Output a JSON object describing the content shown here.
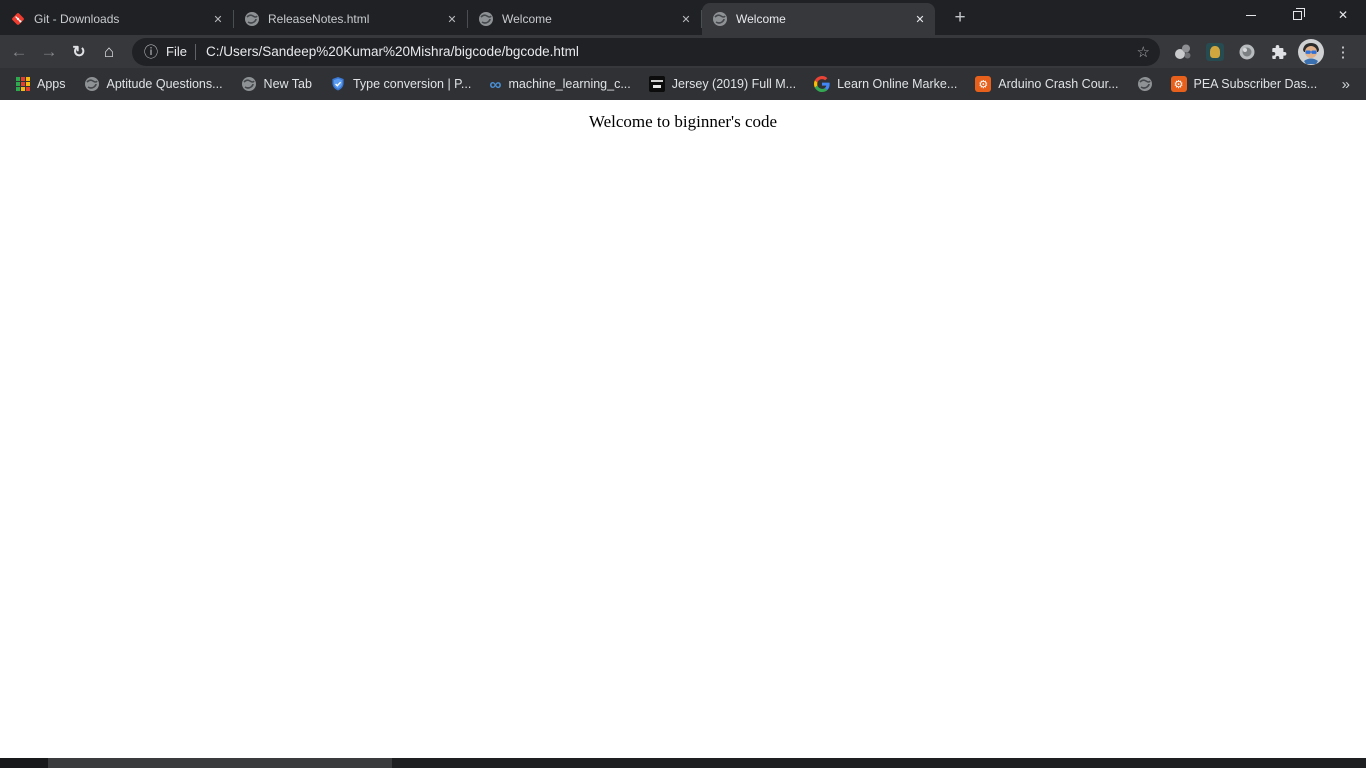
{
  "window_title": "Welcome",
  "tabs": [
    {
      "title": "Git - Downloads",
      "icon": "git",
      "active": false
    },
    {
      "title": "ReleaseNotes.html",
      "icon": "globe",
      "active": false
    },
    {
      "title": "Welcome",
      "icon": "globe",
      "active": false
    },
    {
      "title": "Welcome",
      "icon": "globe",
      "active": true
    }
  ],
  "icons": {
    "tab_close": "✕",
    "new_tab": "+",
    "window_close": "✕",
    "back": "←",
    "forward": "→",
    "reload": "↻",
    "home": "⌂",
    "info": "ⓘ",
    "star": "☆",
    "menu_kebab": "⋮",
    "gear": "⚙",
    "infinity": "∞",
    "overflow": "»"
  },
  "omnibox": {
    "scheme_label": "File",
    "url": "C:/Users/Sandeep%20Kumar%20Mishra/bigcode/bgcode.html"
  },
  "bookmarks": {
    "items": [
      {
        "label": "Apps",
        "icon": "apps-grid"
      },
      {
        "label": "Aptitude Questions...",
        "icon": "globe"
      },
      {
        "label": "New Tab",
        "icon": "globe"
      },
      {
        "label": "Type conversion | P...",
        "icon": "shield"
      },
      {
        "label": "machine_learning_c...",
        "icon": "infinity"
      },
      {
        "label": "Jersey (2019) Full M...",
        "icon": "movie"
      },
      {
        "label": "Learn Online Marke...",
        "icon": "google-g"
      },
      {
        "label": "Arduino Crash Cour...",
        "icon": "robot"
      },
      {
        "label": "",
        "icon": "globe"
      },
      {
        "label": "PEA Subscriber Das...",
        "icon": "robot"
      }
    ]
  },
  "page": {
    "heading": "Welcome to biginner's code"
  },
  "colors": {
    "frame": "#202124",
    "toolbar": "#37383c",
    "bookmarks_bar": "#2f3134",
    "omnibox_bg": "#202124",
    "active_tab_bg": "#37383c",
    "page_bg": "#ffffff",
    "git_icon": "#f03c2e",
    "shield_icon": "#4d90fe",
    "infinity_icon": "#4a8fd4",
    "robot_icon": "#e8611c",
    "scroll_thumb": "#3a3b3d",
    "scroll_track": "#1e1f21"
  }
}
